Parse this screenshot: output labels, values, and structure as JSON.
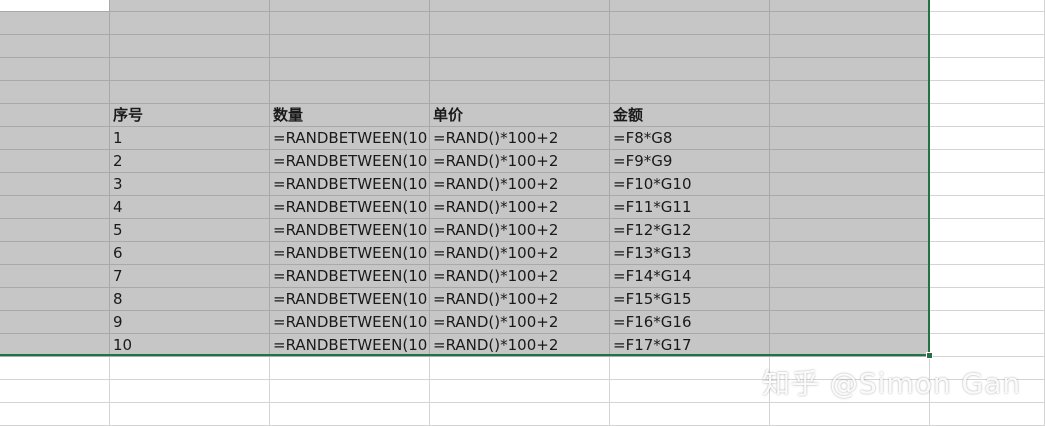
{
  "sheet": {
    "headers": [
      "序号",
      "数量",
      "单价",
      "金额"
    ],
    "rows": [
      [
        "1",
        "=RANDBETWEEN(10",
        "=RAND()*100+2",
        "=F8*G8"
      ],
      [
        "2",
        "=RANDBETWEEN(10",
        "=RAND()*100+2",
        "=F9*G9"
      ],
      [
        "3",
        "=RANDBETWEEN(10",
        "=RAND()*100+2",
        "=F10*G10"
      ],
      [
        "4",
        "=RANDBETWEEN(10",
        "=RAND()*100+2",
        "=F11*G11"
      ],
      [
        "5",
        "=RANDBETWEEN(10",
        "=RAND()*100+2",
        "=F12*G12"
      ],
      [
        "6",
        "=RANDBETWEEN(10",
        "=RAND()*100+2",
        "=F13*G13"
      ],
      [
        "7",
        "=RANDBETWEEN(10",
        "=RAND()*100+2",
        "=F14*G14"
      ],
      [
        "8",
        "=RANDBETWEEN(10",
        "=RAND()*100+2",
        "=F15*G15"
      ],
      [
        "9",
        "=RANDBETWEEN(10",
        "=RAND()*100+2",
        "=F16*G16"
      ],
      [
        "10",
        "=RANDBETWEEN(10",
        "=RAND()*100+2",
        "=F17*G17"
      ]
    ]
  },
  "watermark": "知乎 @Simon Gan",
  "colors": {
    "selection_fill": "#c6c6c6",
    "selection_border": "#217346",
    "gridline": "#d4d4d4"
  }
}
